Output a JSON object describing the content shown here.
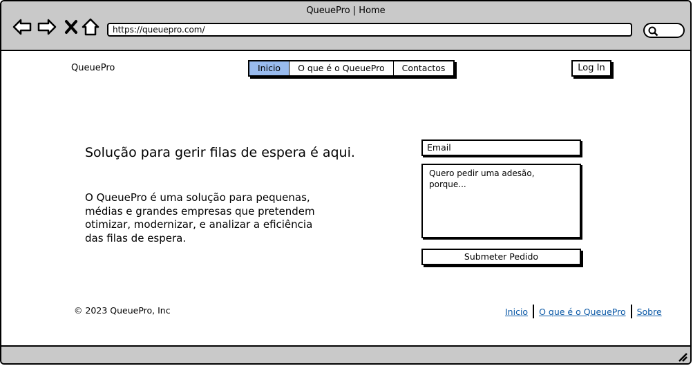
{
  "window": {
    "title": "QueuePro | Home",
    "url": "https://queuepro.com/"
  },
  "icons": {
    "back": "arrow-left-icon",
    "forward": "arrow-right-icon",
    "stop": "close-icon",
    "home": "home-icon",
    "search": "search-icon",
    "resize": "resize-grip-icon"
  },
  "header": {
    "brand": "QueuePro",
    "nav": [
      {
        "label": "Inicio",
        "active": true
      },
      {
        "label": "O que é o QueuePro",
        "active": false
      },
      {
        "label": "Contactos",
        "active": false
      }
    ],
    "login_label": "Log In"
  },
  "hero": {
    "headline": "Solução para gerir filas de espera é aqui.",
    "description": "O QueuePro é uma solução para pequenas, médias e grandes empresas que pretendem otimizar, modernizar, e analizar a eficiência das filas de espera."
  },
  "form": {
    "email_placeholder": "Email",
    "message_placeholder": "Quero pedir uma adesão, porque...",
    "submit_label": "Submeter Pedido"
  },
  "footer": {
    "copyright": "© 2023 QueuePro, Inc",
    "links": [
      "Inicio",
      "O que é o QueuePro",
      "Sobre"
    ]
  },
  "colors": {
    "chrome": "#c9c9c9",
    "active_nav": "#99bbee",
    "link": "#0a58a6"
  }
}
